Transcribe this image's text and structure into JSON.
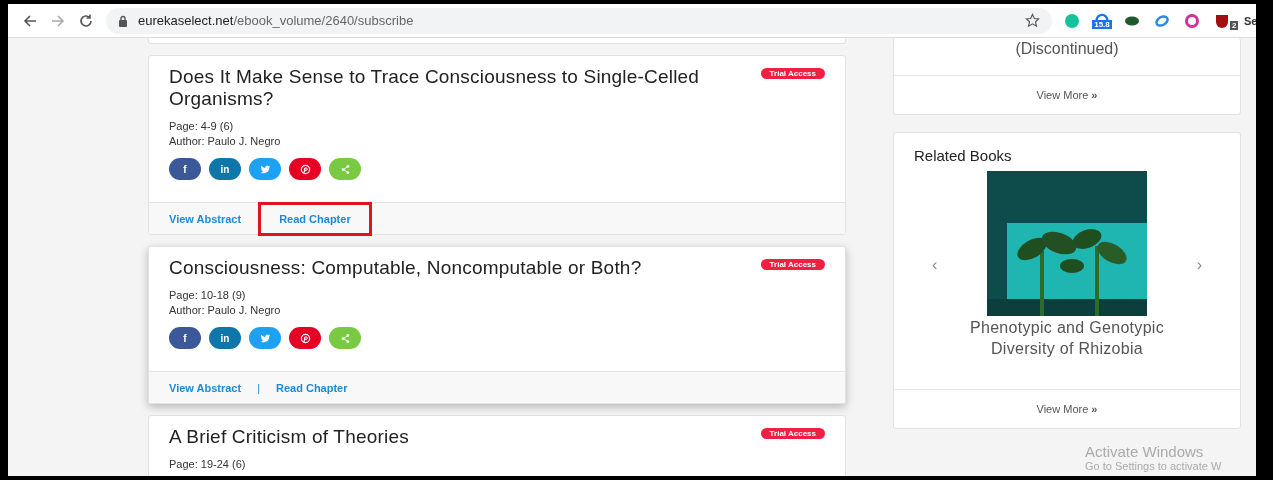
{
  "browser": {
    "url_host": "eurekaselect.net",
    "url_path": "/ebook_volume/2640/subscribe",
    "extensions": [
      {
        "kind": "grammar",
        "color": "#15c39a"
      },
      {
        "kind": "meter",
        "color": "#1a73e8",
        "badge": "15.8"
      },
      {
        "kind": "eye",
        "color": "#1e5a2e"
      },
      {
        "kind": "swirl",
        "color": "#2a8ae0"
      },
      {
        "kind": "ring",
        "color": "#d0309a"
      },
      {
        "kind": "shield",
        "color": "#a01010",
        "badge": "2"
      }
    ],
    "cut_label": "Se"
  },
  "chapters": [
    {
      "title": "Does It Make Sense to Trace Consciousness to Single-Celled Organisms?",
      "badge": "Trial Access",
      "page": "Page: 4-9 (6)",
      "author": "Author: Paulo J. Negro",
      "hovered": false,
      "shares": [
        {
          "kind": "glyph",
          "glyph": "f",
          "color": "#3b5998"
        },
        {
          "kind": "glyph",
          "glyph": "in",
          "color": "#0e76a8"
        },
        {
          "kind": "twitter",
          "color": "#1da1f2"
        },
        {
          "kind": "pinterest",
          "color": "#e60023"
        },
        {
          "kind": "share",
          "color": "#7ac943"
        }
      ],
      "actions": [
        {
          "label": "View Abstract",
          "highlighted": false
        },
        {
          "label": "Read Chapter",
          "highlighted": true
        }
      ]
    },
    {
      "title": "Consciousness: Computable, Noncomputable or Both?",
      "badge": "Trial Access",
      "page": "Page: 10-18 (9)",
      "author": "Author: Paulo J. Negro",
      "hovered": true,
      "shares": [
        {
          "kind": "glyph",
          "glyph": "f",
          "color": "#3b5998"
        },
        {
          "kind": "glyph",
          "glyph": "in",
          "color": "#0e76a8"
        },
        {
          "kind": "twitter",
          "color": "#1da1f2"
        },
        {
          "kind": "pinterest",
          "color": "#e60023"
        },
        {
          "kind": "share",
          "color": "#7ac943"
        }
      ],
      "separator": "|",
      "actions": [
        {
          "label": "View Abstract",
          "highlighted": false
        },
        {
          "label": "Read Chapter",
          "highlighted": false
        }
      ]
    },
    {
      "title": "A Brief Criticism of Theories",
      "badge": "Trial Access",
      "page": "Page: 19-24 (6)",
      "hovered": false
    }
  ],
  "sidebar": {
    "discontinued": {
      "text": "(Discontinued)",
      "link": "View More",
      "link_icon": "»"
    },
    "related": {
      "title": "Related Books",
      "prev": "‹",
      "next": "›",
      "book_title": "Phenotypic and Genotypic Diversity of Rhizobia",
      "link": "View More",
      "link_icon": "»"
    }
  },
  "os_notice": {
    "title": "Activate Windows",
    "subtitle": "Go to Settings to activate W"
  }
}
